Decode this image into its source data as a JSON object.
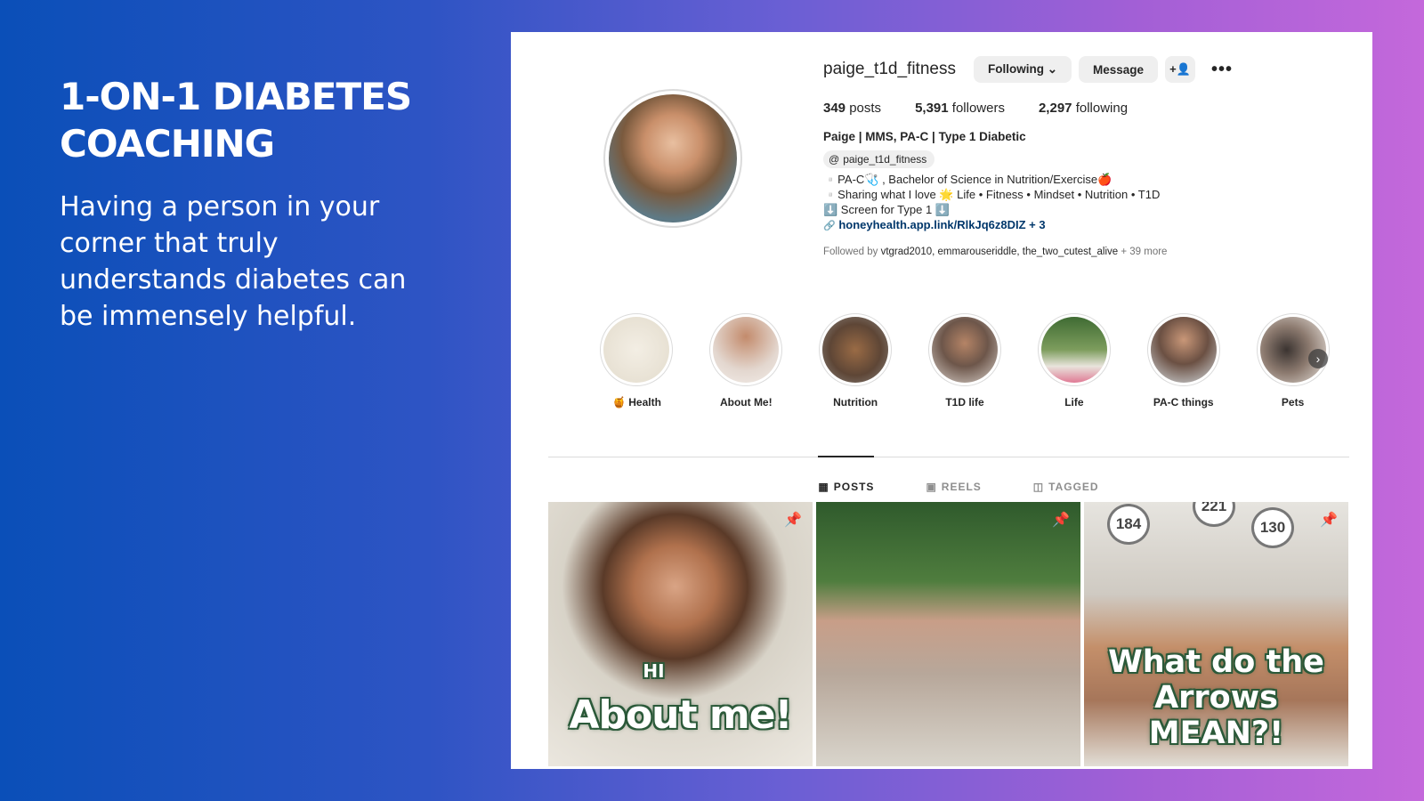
{
  "slide": {
    "headline": "1-ON-1 DIABETES COACHING",
    "subtext": "Having a person in your corner that truly understands diabetes can be immensely helpful."
  },
  "profile": {
    "username": "paige_t1d_fitness",
    "following_btn": "Following ⌄",
    "message_btn": "Message",
    "add_user_icon": "+👤",
    "more_icon": "•••",
    "stats": {
      "posts_count": "349",
      "posts_label": "posts",
      "followers_count": "5,391",
      "followers_label": "followers",
      "following_count": "2,297",
      "following_label": "following"
    },
    "display_name": "Paige | MMS, PA-C | Type 1 Diabetic",
    "threads_handle": "paige_t1d_fitness",
    "bio_line1": "▫️PA-C🩺 , Bachelor of Science in Nutrition/Exercise🍎",
    "bio_line2": "▫️Sharing what I love 🌟 Life • Fitness • Mindset • Nutrition • T1D",
    "bio_line3": "⬇️ Screen for Type 1 ⬇️",
    "bio_link": "honeyhealth.app.link/RlkJq6z8DIZ + 3",
    "followed_by_prefix": "Followed by",
    "followed_by_names": "vtgrad2010, emmarouseriddle, the_two_cutest_alive",
    "followed_by_more": "+ 39 more"
  },
  "highlights": [
    {
      "label": "🍯 Health",
      "color": "#efe9dd"
    },
    {
      "label": "About Me!",
      "color": "#d5b6a2"
    },
    {
      "label": "Nutrition",
      "color": "#8a6a52"
    },
    {
      "label": "T1D life",
      "color": "#c6b3a7"
    },
    {
      "label": "Life",
      "color": "#6f8f5d"
    },
    {
      "label": "PA-C things",
      "color": "#b8a08e"
    },
    {
      "label": "Pets",
      "color": "#8b8178"
    }
  ],
  "tabs": {
    "posts": "POSTS",
    "reels": "REELS",
    "tagged": "TAGGED"
  },
  "posts": {
    "post1_hi": "HI",
    "post1_text": "About me!",
    "post3_text": "What do the Arrows MEAN?!",
    "glucose1": "184",
    "glucose2": "221",
    "glucose3": "130"
  }
}
